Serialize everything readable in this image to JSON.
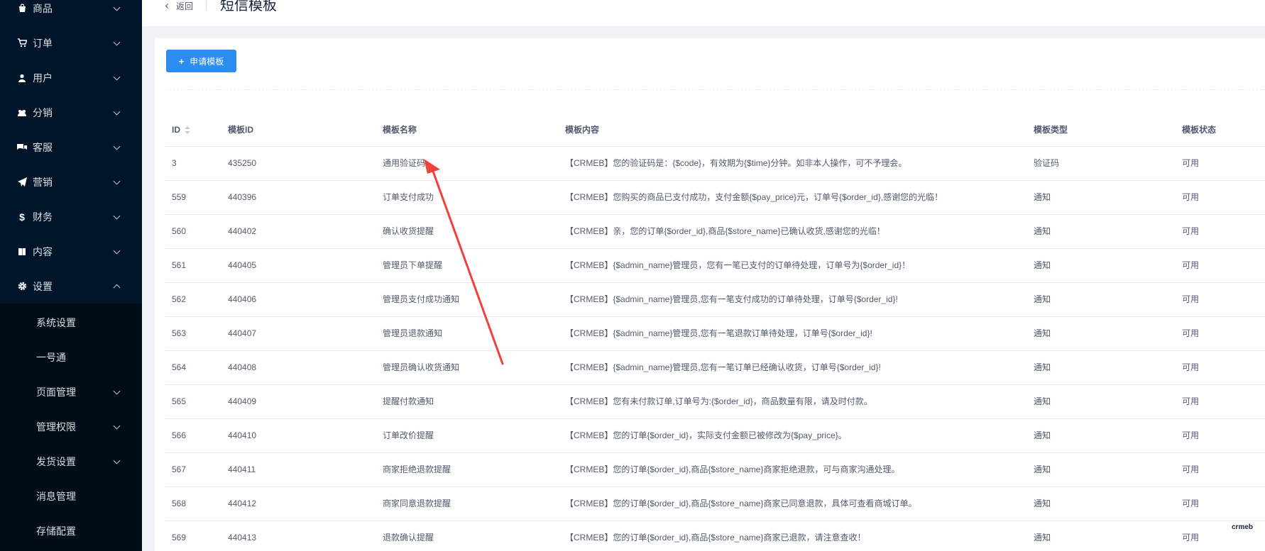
{
  "sidebar": {
    "items": [
      {
        "label": "商品",
        "icon": "shopping-bag-icon"
      },
      {
        "label": "订单",
        "icon": "cart-icon"
      },
      {
        "label": "用户",
        "icon": "user-icon"
      },
      {
        "label": "分销",
        "icon": "team-icon"
      },
      {
        "label": "客服",
        "icon": "chat-icon"
      },
      {
        "label": "营销",
        "icon": "send-icon"
      },
      {
        "label": "财务",
        "icon": "dollar-icon"
      },
      {
        "label": "内容",
        "icon": "book-icon"
      },
      {
        "label": "设置",
        "icon": "gear-icon"
      }
    ],
    "sub_items": [
      {
        "label": "系统设置"
      },
      {
        "label": "一号通"
      },
      {
        "label": "页面管理"
      },
      {
        "label": "管理权限"
      },
      {
        "label": "发货设置"
      },
      {
        "label": "消息管理"
      },
      {
        "label": "存储配置"
      }
    ]
  },
  "header": {
    "back_label": "返回",
    "title": "短信模板"
  },
  "toolbar": {
    "apply_label": "申请模板",
    "plus": "+"
  },
  "table": {
    "columns": [
      "ID",
      "模板ID",
      "模板名称",
      "模板内容",
      "模板类型",
      "模板状态"
    ],
    "rows": [
      {
        "id": "3",
        "tid": "435250",
        "name": "通用验证码",
        "content": "【CRMEB】您的验证码是：{$code}，有效期为{$time}分钟。如非本人操作，可不予理会。",
        "type": "验证码",
        "status": "可用"
      },
      {
        "id": "559",
        "tid": "440396",
        "name": "订单支付成功",
        "content": "【CRMEB】您购买的商品已支付成功，支付金额{$pay_price}元，订单号{$order_id},感谢您的光临！",
        "type": "通知",
        "status": "可用"
      },
      {
        "id": "560",
        "tid": "440402",
        "name": "确认收货提醒",
        "content": "【CRMEB】亲，您的订单{$order_id},商品{$store_name}已确认收货,感谢您的光临！",
        "type": "通知",
        "status": "可用"
      },
      {
        "id": "561",
        "tid": "440405",
        "name": "管理员下单提醒",
        "content": "【CRMEB】{$admin_name}管理员，您有一笔已支付的订单待处理，订单号为{$order_id}！",
        "type": "通知",
        "status": "可用"
      },
      {
        "id": "562",
        "tid": "440406",
        "name": "管理员支付成功通知",
        "content": "【CRMEB】{$admin_name}管理员,您有一笔支付成功的订单待处理，订单号{$order_id}!",
        "type": "通知",
        "status": "可用"
      },
      {
        "id": "563",
        "tid": "440407",
        "name": "管理员退款通知",
        "content": "【CRMEB】{$admin_name}管理员,您有一笔退款订单待处理，订单号{$order_id}!",
        "type": "通知",
        "status": "可用"
      },
      {
        "id": "564",
        "tid": "440408",
        "name": "管理员确认收货通知",
        "content": "【CRMEB】{$admin_name}管理员,您有一笔订单已经确认收货，订单号{$order_id}!",
        "type": "通知",
        "status": "可用"
      },
      {
        "id": "565",
        "tid": "440409",
        "name": "提醒付款通知",
        "content": "【CRMEB】您有未付款订单,订单号为:{$order_id}，商品数量有限，请及时付款。",
        "type": "通知",
        "status": "可用"
      },
      {
        "id": "566",
        "tid": "440410",
        "name": "订单改价提醒",
        "content": "【CRMEB】您的订单{$order_id}，实际支付金额已被修改为{$pay_price}。",
        "type": "通知",
        "status": "可用"
      },
      {
        "id": "567",
        "tid": "440411",
        "name": "商家拒绝退款提醒",
        "content": "【CRMEB】您的订单{$order_id},商品{$store_name}商家拒绝退款，可与商家沟通处理。",
        "type": "通知",
        "status": "可用"
      },
      {
        "id": "568",
        "tid": "440412",
        "name": "商家同意退款提醒",
        "content": "【CRMEB】您的订单{$order_id},商品{$store_name}商家已同意退款，具体可查看商城订单。",
        "type": "通知",
        "status": "可用"
      },
      {
        "id": "569",
        "tid": "440413",
        "name": "退款确认提醒",
        "content": "【CRMEB】您的订单{$order_id},商品{$store_name}商家已退款，请注意查收！",
        "type": "通知",
        "status": "可用"
      }
    ]
  },
  "watermark": "crmeb",
  "colors": {
    "sidebar_bg": "#001529",
    "submenu_bg": "#000c17",
    "primary": "#2d8cf0",
    "arrow": "#f0413c"
  }
}
